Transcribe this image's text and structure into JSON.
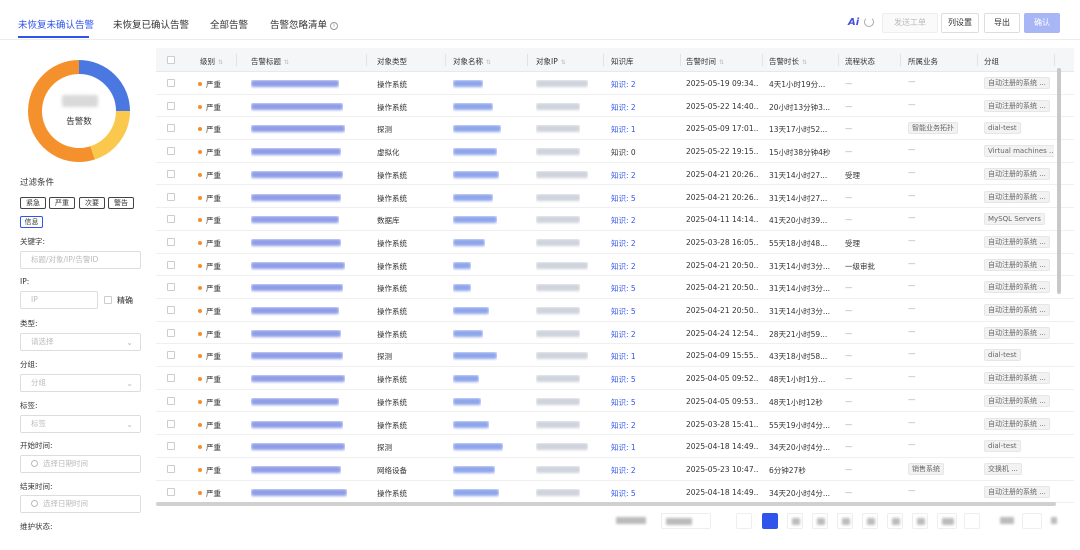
{
  "tabs": [
    {
      "label": "未恢复未确认告警",
      "active": true
    },
    {
      "label": "未恢复已确认告警",
      "active": false
    },
    {
      "label": "全部告警",
      "active": false
    },
    {
      "label": "告警忽略清单",
      "active": false
    }
  ],
  "toolbar": {
    "ai_label": "Ai",
    "send_ticket": "发送工单",
    "column_settings": "列设置",
    "export": "导出",
    "confirm": "确认"
  },
  "donut": {
    "label": "告警数",
    "colors": [
      "#4a78e0",
      "#f9c84c",
      "#f5912d"
    ],
    "shares": [
      0.25,
      0.2,
      0.55
    ]
  },
  "filters": {
    "title": "过滤条件",
    "levels": [
      "紧急",
      "严重",
      "次要",
      "警告",
      "信息"
    ],
    "keyword_label": "关键字:",
    "keyword_placeholder": "标题/对象/IP/告警ID",
    "ip_label": "IP:",
    "ip_placeholder": "IP",
    "exact_label": "精确",
    "type_label": "类型:",
    "type_placeholder": "请选择",
    "group_label": "分组:",
    "group_placeholder": "分组",
    "tag_label": "标签:",
    "tag_placeholder": "标签",
    "start_label": "开始时间:",
    "start_placeholder": "选择日期时间",
    "end_label": "结束时间:",
    "end_placeholder": "选择日期时间",
    "maint_label": "维护状态:"
  },
  "table": {
    "columns": [
      "级别",
      "告警标题",
      "对象类型",
      "对象名称",
      "对象IP",
      "知识库",
      "告警时间",
      "告警时长",
      "流程状态",
      "所属业务",
      "分组"
    ],
    "rows": [
      {
        "level": "严重",
        "type": "操作系统",
        "kb": "知识: 2",
        "time": "2025-05-19 09:34...",
        "dur": "4天1小时19分...",
        "flow": "—",
        "biz": "—",
        "group": "自动注册的系统 ..."
      },
      {
        "level": "严重",
        "type": "操作系统",
        "kb": "知识: 2",
        "time": "2025-05-22 14:40...",
        "dur": "20小时13分钟3...",
        "flow": "—",
        "biz": "—",
        "group": "自动注册的系统 ..."
      },
      {
        "level": "严重",
        "type": "探测",
        "kb": "知识: 1",
        "time": "2025-05-09 17:01...",
        "dur": "13天17小时52...",
        "flow": "—",
        "biz": "智能业务拓扑",
        "group": "dial-test"
      },
      {
        "level": "严重",
        "type": "虚拟化",
        "kb": "知识: 0",
        "time": "2025-05-22 19:15...",
        "dur": "15小时38分钟4秒",
        "flow": "—",
        "biz": "—",
        "group": "Virtual machines ..."
      },
      {
        "level": "严重",
        "type": "操作系统",
        "kb": "知识: 2",
        "time": "2025-04-21 20:26...",
        "dur": "31天14小时27...",
        "flow": "受理",
        "biz": "—",
        "group": "自动注册的系统 ..."
      },
      {
        "level": "严重",
        "type": "操作系统",
        "kb": "知识: 5",
        "time": "2025-04-21 20:26...",
        "dur": "31天14小时27...",
        "flow": "—",
        "biz": "—",
        "group": "自动注册的系统 ..."
      },
      {
        "level": "严重",
        "type": "数据库",
        "kb": "知识: 2",
        "time": "2025-04-11 14:14...",
        "dur": "41天20小时39...",
        "flow": "—",
        "biz": "—",
        "group": "MySQL Servers"
      },
      {
        "level": "严重",
        "type": "操作系统",
        "kb": "知识: 2",
        "time": "2025-03-28 16:05...",
        "dur": "55天18小时48...",
        "flow": "受理",
        "biz": "—",
        "group": "自动注册的系统 ..."
      },
      {
        "level": "严重",
        "type": "操作系统",
        "kb": "知识: 2",
        "time": "2025-04-21 20:50...",
        "dur": "31天14小时3分...",
        "flow": "一级审批",
        "biz": "—",
        "group": "自动注册的系统 ..."
      },
      {
        "level": "严重",
        "type": "操作系统",
        "kb": "知识: 5",
        "time": "2025-04-21 20:50...",
        "dur": "31天14小时3分...",
        "flow": "—",
        "biz": "—",
        "group": "自动注册的系统 ..."
      },
      {
        "level": "严重",
        "type": "操作系统",
        "kb": "知识: 5",
        "time": "2025-04-21 20:50...",
        "dur": "31天14小时3分...",
        "flow": "—",
        "biz": "—",
        "group": "自动注册的系统 ..."
      },
      {
        "level": "严重",
        "type": "操作系统",
        "kb": "知识: 2",
        "time": "2025-04-24 12:54...",
        "dur": "28天21小时59...",
        "flow": "—",
        "biz": "—",
        "group": "自动注册的系统 ..."
      },
      {
        "level": "严重",
        "type": "探测",
        "kb": "知识: 1",
        "time": "2025-04-09 15:55...",
        "dur": "43天18小时58...",
        "flow": "—",
        "biz": "—",
        "group": "dial-test"
      },
      {
        "level": "严重",
        "type": "操作系统",
        "kb": "知识: 5",
        "time": "2025-04-05 09:52...",
        "dur": "48天1小时1分...",
        "flow": "—",
        "biz": "—",
        "group": "自动注册的系统 ..."
      },
      {
        "level": "严重",
        "type": "操作系统",
        "kb": "知识: 5",
        "time": "2025-04-05 09:53...",
        "dur": "48天1小时12秒",
        "flow": "—",
        "biz": "—",
        "group": "自动注册的系统 ..."
      },
      {
        "level": "严重",
        "type": "操作系统",
        "kb": "知识: 2",
        "time": "2025-03-28 15:41...",
        "dur": "55天19小时4分...",
        "flow": "—",
        "biz": "—",
        "group": "自动注册的系统 ..."
      },
      {
        "level": "严重",
        "type": "探测",
        "kb": "知识: 1",
        "time": "2025-04-18 14:49...",
        "dur": "34天20小时4分...",
        "flow": "—",
        "biz": "—",
        "group": "dial-test"
      },
      {
        "level": "严重",
        "type": "网络设备",
        "kb": "知识: 2",
        "time": "2025-05-23 10:47...",
        "dur": "6分钟27秒",
        "flow": "—",
        "biz": "销售系统",
        "group": "交换机 ..."
      },
      {
        "level": "严重",
        "type": "操作系统",
        "kb": "知识: 5",
        "time": "2025-04-18 14:49...",
        "dur": "34天20小时4分...",
        "flow": "—",
        "biz": "—",
        "group": "自动注册的系统 ..."
      }
    ]
  },
  "colors": {
    "accent": "#2f54eb",
    "severity_dot": "#f58d2c"
  }
}
